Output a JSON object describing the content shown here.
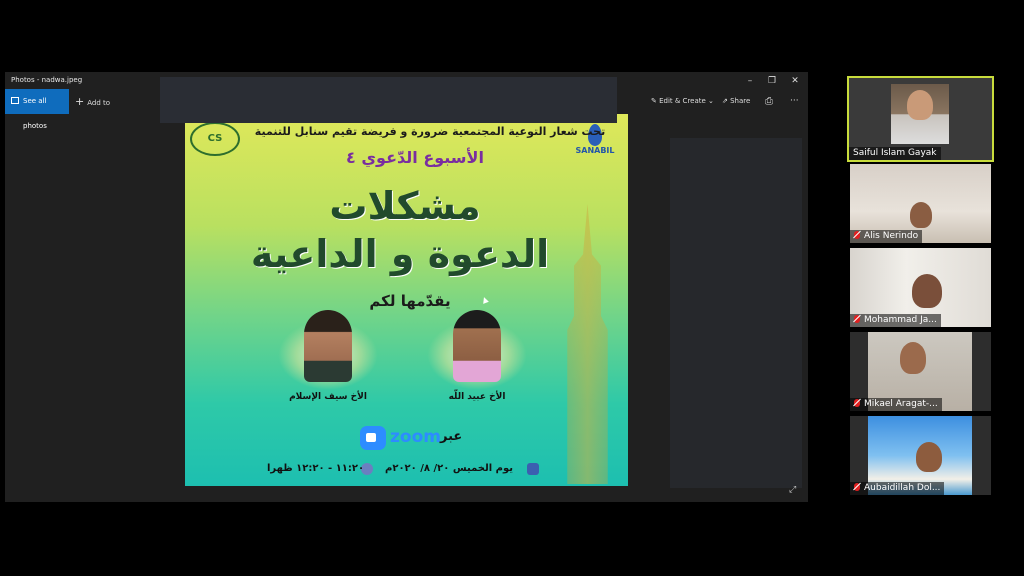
{
  "window": {
    "title": "Photos - nadwa.jpeg",
    "minimize": "–",
    "maximize": "❐",
    "close": "✕"
  },
  "toolbar": {
    "see_all_photos": "See all photos",
    "add_to": "Add to",
    "edit_create": "Edit & Create",
    "share": "Share",
    "print": "⎙",
    "more": "···"
  },
  "poster": {
    "tagline": "تحت شعار التوعية المجتمعية ضرورة و فريضة تقيم سنابل للتنمية",
    "week": "الأسبوع الدّعوي ٤",
    "title_line1": "مشكلات",
    "title_line2": "الدعوة و الداعية",
    "presented_by": "يقدّمها لكم",
    "speaker_1": "الأخ سيف الإسلام",
    "speaker_2": "الأخ عبيد اللّه",
    "via": "عبر",
    "zoom": "zoom",
    "date": "يوم الخميس ٢٠/ ٨/ ٢٠٢٠م",
    "time": "١١:٢٠ - ١٢:٢٠ ظهرا",
    "logo_left": "CS",
    "logo_right": "SANABIL"
  },
  "participants": [
    {
      "name": "Saiful Islam Gayak",
      "muted": false
    },
    {
      "name": "Alis Nerindo",
      "muted": true
    },
    {
      "name": "Mohammad Ja...",
      "muted": true
    },
    {
      "name": "Mikael Aragat-...",
      "muted": true
    },
    {
      "name": "Aubaidillah Dol...",
      "muted": true
    }
  ],
  "colors": {
    "accent": "#0f6cbd",
    "active_speaker": "#c8dc3c",
    "muted": "#e02020"
  }
}
